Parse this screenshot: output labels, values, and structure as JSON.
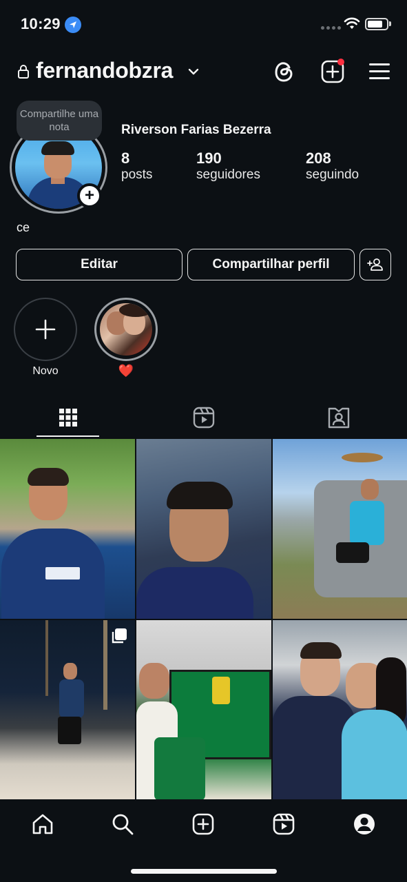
{
  "status_bar": {
    "time": "10:29"
  },
  "header": {
    "username": "fernandobzra"
  },
  "profile": {
    "note_bubble": "Compartilhe uma nota",
    "full_name": "Riverson Farias Bezerra",
    "stats": [
      {
        "value": "8",
        "label": "posts"
      },
      {
        "value": "190",
        "label": "seguidores"
      },
      {
        "value": "208",
        "label": "seguindo"
      }
    ],
    "bio": "ce"
  },
  "actions": {
    "edit_label": "Editar",
    "share_label": "Compartilhar perfil"
  },
  "highlights": [
    {
      "label": "Novo"
    },
    {
      "label": "❤️"
    }
  ],
  "tabs": [
    "grid-icon",
    "reels-icon",
    "tagged-icon"
  ],
  "nav": [
    "home-icon",
    "search-icon",
    "create-icon",
    "reels-icon",
    "profile-icon"
  ],
  "colors": {
    "background": "#0c1014",
    "text": "#f5f5f5",
    "notification": "#ff3040",
    "location": "#3b8cf6"
  }
}
